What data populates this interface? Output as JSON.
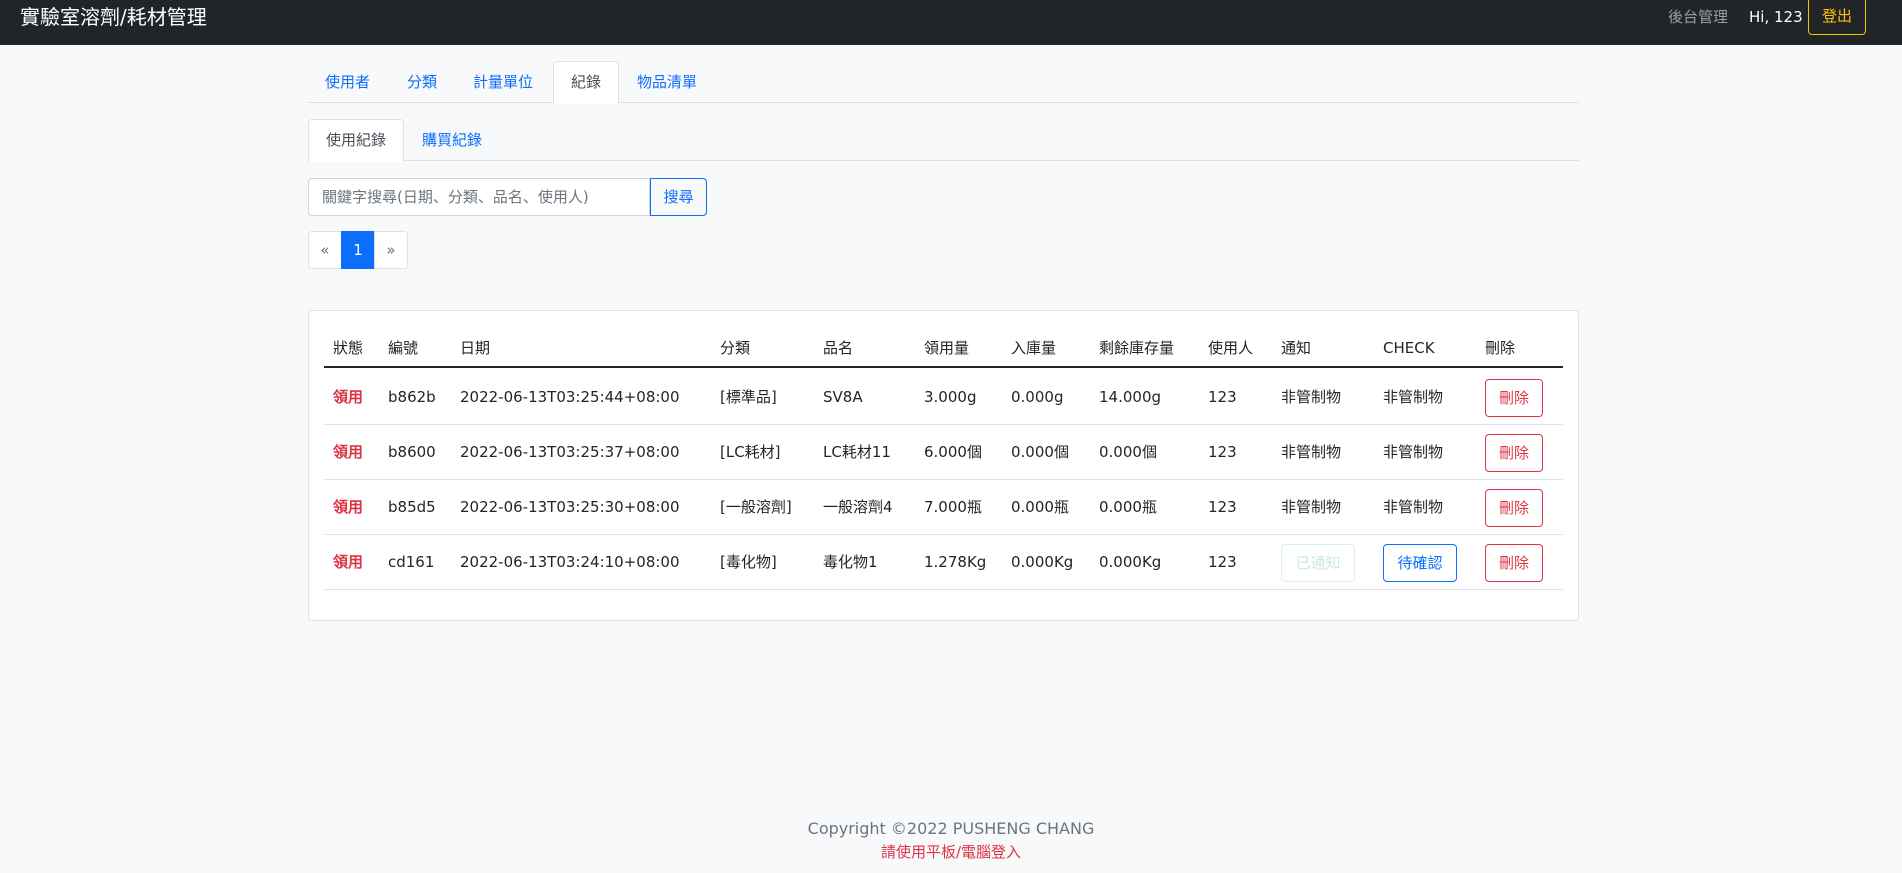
{
  "navbar": {
    "brand": "實驗室溶劑/耗材管理",
    "admin_link": "後台管理",
    "greeting": "Hi, 123",
    "logout_label": "登出"
  },
  "main_tabs": [
    {
      "label": "使用者",
      "active": false
    },
    {
      "label": "分類",
      "active": false
    },
    {
      "label": "計量單位",
      "active": false
    },
    {
      "label": "紀錄",
      "active": true
    },
    {
      "label": "物品清單",
      "active": false
    }
  ],
  "sub_tabs": [
    {
      "label": "使用紀錄",
      "active": true
    },
    {
      "label": "購買紀錄",
      "active": false
    }
  ],
  "search": {
    "placeholder": "關鍵字搜尋(日期、分類、品名、使用人)",
    "value": "",
    "button_label": "搜尋"
  },
  "pagination": {
    "prev": "«",
    "current": "1",
    "next": "»"
  },
  "table": {
    "headers": [
      "狀態",
      "編號",
      "日期",
      "分類",
      "品名",
      "領用量",
      "入庫量",
      "剩餘庫存量",
      "使用人",
      "通知",
      "CHECK",
      "刪除"
    ],
    "rows": [
      {
        "status": "領用",
        "id": "b862b",
        "date": "2022-06-13T03:25:44+08:00",
        "category": "[標準品]",
        "name": "SV8A",
        "used": "3.000g",
        "stocked": "0.000g",
        "remaining": "14.000g",
        "user": "123",
        "notify": "非管制物",
        "check": "非管制物",
        "delete": "刪除"
      },
      {
        "status": "領用",
        "id": "b8600",
        "date": "2022-06-13T03:25:37+08:00",
        "category": "[LC耗材]",
        "name": "LC耗材11",
        "used": "6.000個",
        "stocked": "0.000個",
        "remaining": "0.000個",
        "user": "123",
        "notify": "非管制物",
        "check": "非管制物",
        "delete": "刪除"
      },
      {
        "status": "領用",
        "id": "b85d5",
        "date": "2022-06-13T03:25:30+08:00",
        "category": "[一般溶劑]",
        "name": "一般溶劑4",
        "used": "7.000瓶",
        "stocked": "0.000瓶",
        "remaining": "0.000瓶",
        "user": "123",
        "notify": "非管制物",
        "check": "非管制物",
        "delete": "刪除"
      },
      {
        "status": "領用",
        "id": "cd161",
        "date": "2022-06-13T03:24:10+08:00",
        "category": "[毒化物]",
        "name": "毒化物1",
        "used": "1.278Kg",
        "stocked": "0.000Kg",
        "remaining": "0.000Kg",
        "user": "123",
        "notify_button": "已通知",
        "check_button": "待確認",
        "delete": "刪除"
      }
    ]
  },
  "footer": {
    "copyright": "Copyright ©2022 PUSHENG CHANG",
    "note": "請使用平板/電腦登入"
  },
  "colors": {
    "navbar_bg": "#212529",
    "accent": "#0d6efd",
    "danger": "#dc3545",
    "warning": "#ffc107"
  }
}
